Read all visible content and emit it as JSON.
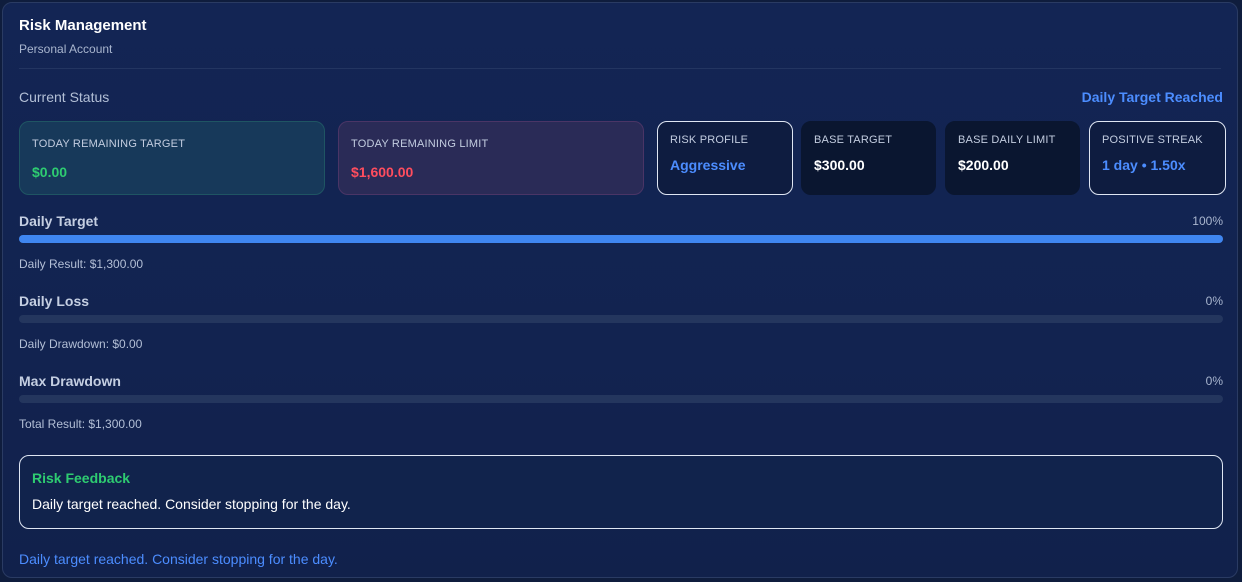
{
  "header": {
    "title": "Risk Management",
    "subtitle": "Personal Account"
  },
  "status": {
    "label": "Current Status",
    "badge": "Daily Target Reached"
  },
  "cards": {
    "remaining_target": {
      "label": "TODAY REMAINING TARGET",
      "value": "$0.00"
    },
    "remaining_limit": {
      "label": "TODAY REMAINING LIMIT",
      "value": "$1,600.00"
    },
    "risk_profile": {
      "label": "RISK PROFILE",
      "value": "Aggressive"
    },
    "base_target": {
      "label": "BASE TARGET",
      "value": "$300.00"
    },
    "base_daily_limit": {
      "label": "BASE DAILY LIMIT",
      "value": "$200.00"
    },
    "positive_streak": {
      "label": "POSITIVE STREAK",
      "value": "1 day • 1.50x"
    }
  },
  "metrics": [
    {
      "name": "Daily Target",
      "percent_label": "100%",
      "progress": 1.0,
      "result": "Daily Result: $1,300.00"
    },
    {
      "name": "Daily Loss",
      "percent_label": "0%",
      "progress": 0.0,
      "result": "Daily Drawdown: $0.00"
    },
    {
      "name": "Max Drawdown",
      "percent_label": "0%",
      "progress": 0.0,
      "result": "Total Result: $1,300.00"
    }
  ],
  "feedback": {
    "title": "Risk Feedback",
    "text": "Daily target reached. Consider stopping for the day."
  },
  "footer": {
    "note": "Daily target reached. Consider stopping for the day."
  },
  "colors": {
    "accent": "#4c8dff",
    "positive": "#2ecc71",
    "negative": "#ff4d5e",
    "bar": "#3f86f0"
  }
}
